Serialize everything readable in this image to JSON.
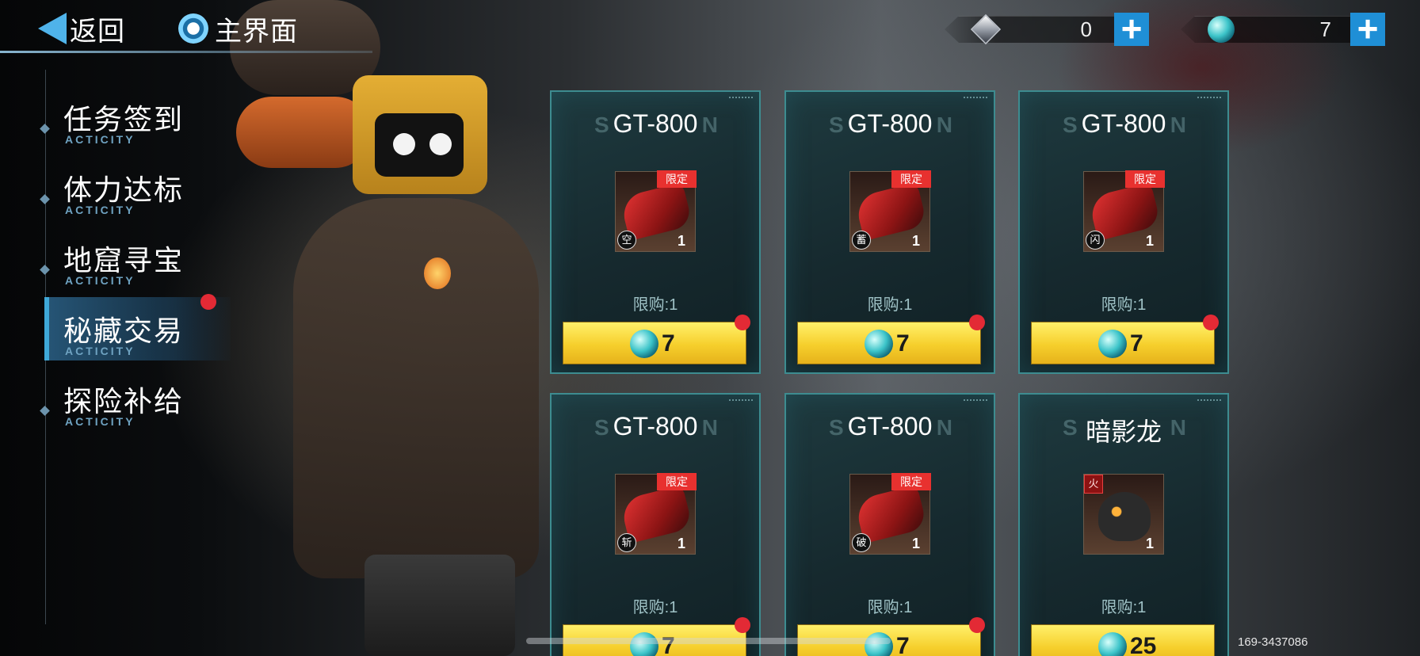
{
  "nav": {
    "back_label": "返回",
    "home_label": "主界面"
  },
  "currency": [
    {
      "icon": "diamond-icon",
      "value": "0"
    },
    {
      "icon": "orb-icon",
      "value": "7"
    }
  ],
  "menu": [
    {
      "title": "任务签到",
      "sub": "ACTICITY",
      "active": false,
      "badge": false
    },
    {
      "title": "体力达标",
      "sub": "ACTICITY",
      "active": false,
      "badge": false
    },
    {
      "title": "地窟寻宝",
      "sub": "ACTICITY",
      "active": false,
      "badge": false
    },
    {
      "title": "秘藏交易",
      "sub": "ACTICITY",
      "active": true,
      "badge": true
    },
    {
      "title": "探险补给",
      "sub": "ACTICITY",
      "active": false,
      "badge": false
    }
  ],
  "cards": [
    {
      "name": "GT-800",
      "ghost_left": "S",
      "ghost_right": "N",
      "tag": "限定",
      "element": "空",
      "qty": "1",
      "limit": "限购:1",
      "price": "7"
    },
    {
      "name": "GT-800",
      "ghost_left": "S",
      "ghost_right": "N",
      "tag": "限定",
      "element": "蓄",
      "qty": "1",
      "limit": "限购:1",
      "price": "7"
    },
    {
      "name": "GT-800",
      "ghost_left": "S",
      "ghost_right": "N",
      "tag": "限定",
      "element": "闪",
      "qty": "1",
      "limit": "限购:1",
      "price": "7"
    },
    {
      "name": "GT-800",
      "ghost_left": "S",
      "ghost_right": "N",
      "tag": "限定",
      "element": "斩",
      "qty": "1",
      "limit": "限购:1",
      "price": "7"
    },
    {
      "name": "GT-800",
      "ghost_left": "S",
      "ghost_right": "N",
      "tag": "限定",
      "element": "破",
      "qty": "1",
      "limit": "限购:1",
      "price": "7"
    },
    {
      "name": "暗影龙",
      "ghost_left": "S",
      "ghost_right": "N",
      "tag": "",
      "element": "火",
      "qty": "1",
      "limit": "限购:1",
      "price": "25"
    }
  ],
  "footer_id": "169-3437086"
}
